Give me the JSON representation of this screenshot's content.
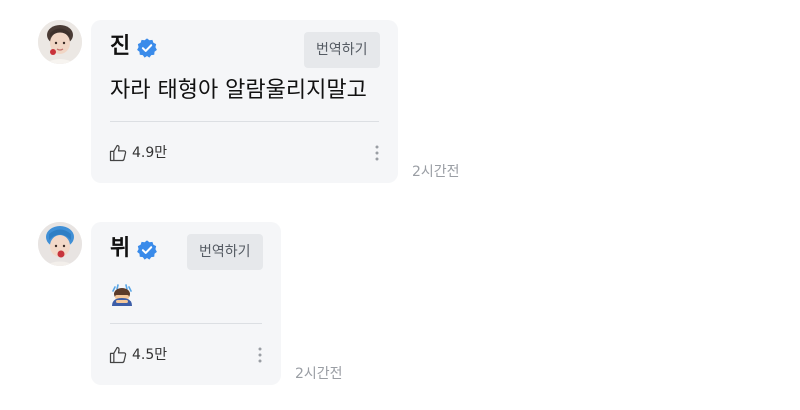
{
  "comments": [
    {
      "author": "진",
      "text": "자라 태형아 알람울리지말고",
      "translate_label": "번역하기",
      "likes": "4.9만",
      "time": "2시간전",
      "avatar_icon": "jin-avatar-icon",
      "verified_icon": "verified-badge-icon"
    },
    {
      "author": "뷔",
      "text_emoji": "bowing-person-emoji",
      "translate_label": "번역하기",
      "likes": "4.5만",
      "time": "2시간전",
      "avatar_icon": "v-avatar-icon",
      "verified_icon": "verified-badge-icon"
    }
  ],
  "colors": {
    "bubble": "#f5f6f8",
    "verified": "#3a8bea",
    "translate_bg": "#e6e8eb",
    "muted": "#9a9ea4"
  }
}
